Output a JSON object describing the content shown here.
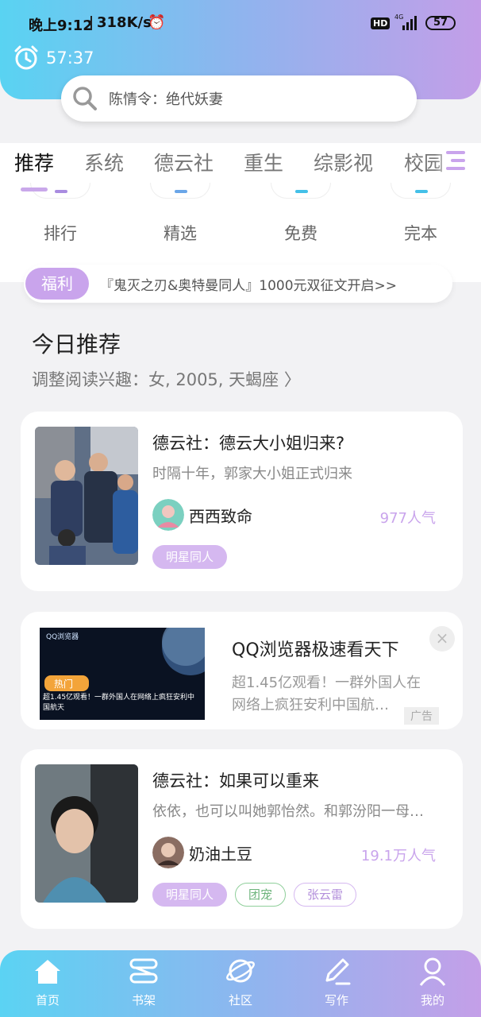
{
  "status_bar": {
    "time": "晚上9:12",
    "speed": "318K/s",
    "network": "4G",
    "hd": "HD",
    "battery": "57"
  },
  "timer": {
    "value": "57:37"
  },
  "search": {
    "placeholder": "陈情令：绝代妖妻"
  },
  "tabs": [
    {
      "label": "推荐",
      "active": true
    },
    {
      "label": "系统"
    },
    {
      "label": "德云社"
    },
    {
      "label": "重生"
    },
    {
      "label": "综影视"
    },
    {
      "label": "校园"
    }
  ],
  "quick_links": [
    {
      "label": "排行",
      "color": "#a98ce0"
    },
    {
      "label": "精选",
      "color": "#6aa6e8"
    },
    {
      "label": "免费",
      "color": "#44c0e8"
    },
    {
      "label": "完本",
      "color": "#44c0e8"
    }
  ],
  "welfare": {
    "badge": "福利",
    "text": "『鬼灭之刃&奥特曼同人』1000元双征文开启>>"
  },
  "section": {
    "title": "今日推荐",
    "subtitle": "调整阅读兴趣：女, 2005, 天蝎座 〉"
  },
  "books": [
    {
      "title": "德云社：德云大小姐归来?",
      "description": "时隔十年，郭家大小姐正式归来",
      "author": "西西致命",
      "popularity": "977人气",
      "tags": [
        "明星同人"
      ]
    },
    {
      "title": "德云社：如果可以重来",
      "description": "依依，也可以叫她郭怡然。和郭汾阳一母…",
      "author": "奶油土豆",
      "popularity": "19.1万人气",
      "tags": [
        "明星同人",
        "团宠",
        "张云雷"
      ]
    }
  ],
  "ad": {
    "title": "QQ浏览器极速看天下",
    "description": "超1.45亿观看！一群外国人在网络上疯狂安利中国航…",
    "mark": "广告",
    "close": "×",
    "cover_brand": "QQ浏览器",
    "cover_hot": "热门",
    "cover_caption": "超1.45亿观看！一群外国人在网络上疯狂安利中国航天"
  },
  "bottom_nav": [
    {
      "label": "首页",
      "icon": "home-icon",
      "active": true
    },
    {
      "label": "书架",
      "icon": "bookshelf-icon"
    },
    {
      "label": "社区",
      "icon": "planet-icon"
    },
    {
      "label": "写作",
      "icon": "pen-icon"
    },
    {
      "label": "我的",
      "icon": "user-icon"
    }
  ]
}
